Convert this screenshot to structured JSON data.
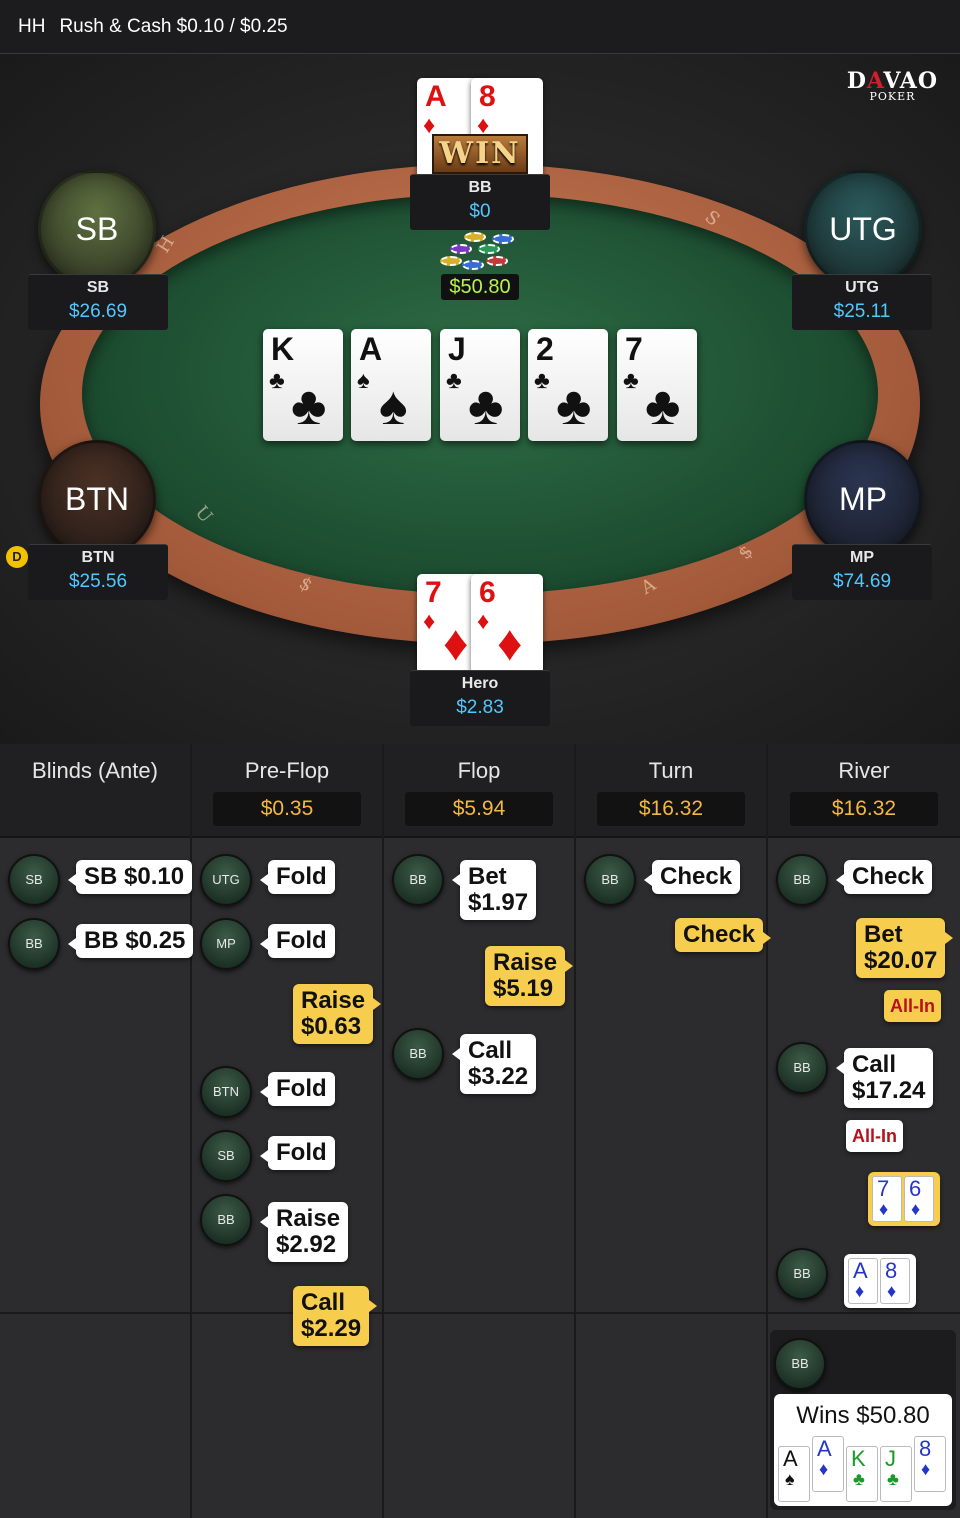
{
  "header": {
    "hh": "HH",
    "title": "Rush & Cash $0.10 / $0.25"
  },
  "logo": {
    "big_d": "D",
    "big_a": "A",
    "big_rest": "VAO",
    "small": "POKER"
  },
  "win_label": "WIN",
  "pot": "$50.80",
  "dealer": "D",
  "seats": {
    "bb": {
      "name": "BB",
      "stack": "$0"
    },
    "sb": {
      "circle": "SB",
      "name": "SB",
      "stack": "$26.69",
      "color": "#5f7040"
    },
    "utg": {
      "circle": "UTG",
      "name": "UTG",
      "stack": "$25.11",
      "color": "#2b5a5c"
    },
    "btn": {
      "circle": "BTN",
      "name": "BTN",
      "stack": "$25.56",
      "color": "#4a3024"
    },
    "mp": {
      "circle": "MP",
      "name": "MP",
      "stack": "$74.69",
      "color": "#2a3552"
    },
    "hero": {
      "name": "Hero",
      "stack": "$2.83"
    }
  },
  "bb_cards": [
    {
      "rank": "A",
      "suit": "♦"
    },
    {
      "rank": "8",
      "suit": "♦"
    }
  ],
  "hero_cards": [
    {
      "rank": "7",
      "suit": "♦"
    },
    {
      "rank": "6",
      "suit": "♦"
    }
  ],
  "board": [
    {
      "rank": "K",
      "suit": "♣"
    },
    {
      "rank": "A",
      "suit": "♠"
    },
    {
      "rank": "J",
      "suit": "♣"
    },
    {
      "rank": "2",
      "suit": "♣"
    },
    {
      "rank": "7",
      "suit": "♣"
    }
  ],
  "columns": [
    {
      "title": "Blinds (Ante)",
      "amount": ""
    },
    {
      "title": "Pre-Flop",
      "amount": "$0.35"
    },
    {
      "title": "Flop",
      "amount": "$5.94"
    },
    {
      "title": "Turn",
      "amount": "$16.32"
    },
    {
      "title": "River",
      "amount": "$16.32"
    }
  ],
  "actions": {
    "blinds_sb": {
      "pos": "SB",
      "text": "SB $0.10"
    },
    "blinds_bb": {
      "pos": "BB",
      "text": "BB $0.25"
    },
    "pf_utg": {
      "pos": "UTG",
      "text": "Fold"
    },
    "pf_mp": {
      "pos": "MP",
      "text": "Fold"
    },
    "pf_hero_raise": {
      "line1": "Raise",
      "line2": "$0.63"
    },
    "pf_btn": {
      "pos": "BTN",
      "text": "Fold"
    },
    "pf_sb": {
      "pos": "SB",
      "text": "Fold"
    },
    "pf_bb": {
      "pos": "BB",
      "line1": "Raise",
      "line2": "$2.92"
    },
    "pf_hero_call": {
      "line1": "Call",
      "line2": "$2.29"
    },
    "flop_bb_bet": {
      "pos": "BB",
      "line1": "Bet",
      "line2": "$1.97"
    },
    "flop_hero_raise": {
      "line1": "Raise",
      "line2": "$5.19"
    },
    "flop_bb_call": {
      "pos": "BB",
      "line1": "Call",
      "line2": "$3.22"
    },
    "turn_bb": {
      "pos": "BB",
      "text": "Check"
    },
    "turn_hero": {
      "text": "Check"
    },
    "river_bb": {
      "pos": "BB",
      "text": "Check"
    },
    "river_hero_bet": {
      "line1": "Bet",
      "line2": "$20.07",
      "allin": "All-In"
    },
    "river_bb_call": {
      "pos": "BB",
      "line1": "Call",
      "line2": "$17.24",
      "allin": "All-In"
    },
    "river_bb_show": {
      "pos": "BB"
    },
    "river_win": {
      "pos": "BB",
      "text": "Wins $50.80"
    }
  },
  "show_hero": [
    {
      "rank": "7",
      "suit": "♦"
    },
    {
      "rank": "6",
      "suit": "♦"
    }
  ],
  "show_bb": [
    {
      "rank": "A",
      "suit": "♦"
    },
    {
      "rank": "8",
      "suit": "♦"
    }
  ],
  "win_hand": [
    {
      "rank": "A",
      "suit": "♠",
      "color": "#111"
    },
    {
      "rank": "A",
      "suit": "♦",
      "color": "#2535c8"
    },
    {
      "rank": "K",
      "suit": "♣",
      "color": "#1a9a2a"
    },
    {
      "rank": "J",
      "suit": "♣",
      "color": "#1a9a2a"
    },
    {
      "rank": "8",
      "suit": "♦",
      "color": "#2535c8"
    }
  ]
}
